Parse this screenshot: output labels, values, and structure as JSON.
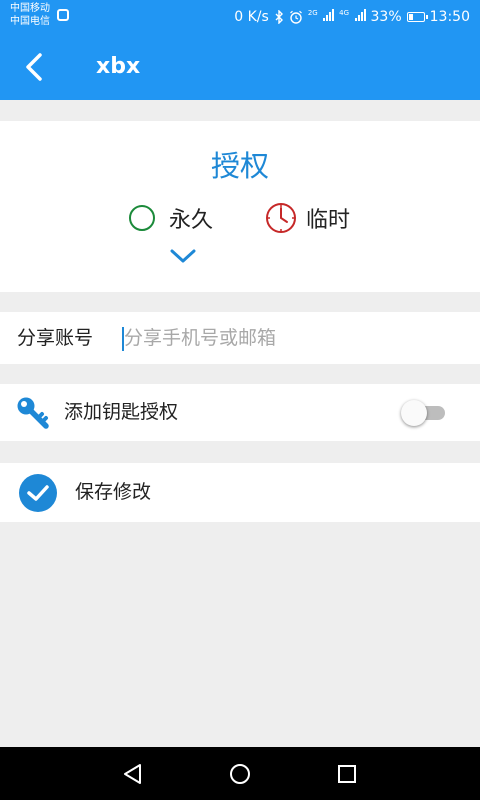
{
  "status_bar": {
    "carrier_1": "中国移动",
    "carrier_2": "中国电信",
    "net_speed": "0 K/s",
    "network_1": "2G",
    "network_2": "4G",
    "battery": "33%",
    "battery_level": 0.33,
    "time": "13:50"
  },
  "app_bar": {
    "title": "xbx"
  },
  "authorization": {
    "title": "授权",
    "options": [
      {
        "label": "永久",
        "icon": "circle-icon",
        "color": "#1b8a3a",
        "selected": true
      },
      {
        "label": "临时",
        "icon": "clock-icon",
        "color": "#c62828",
        "selected": false
      }
    ]
  },
  "share": {
    "label": "分享账号",
    "placeholder": "分享手机号或邮箱",
    "value": ""
  },
  "key_auth": {
    "label": "添加钥匙授权",
    "icon": "key-icon",
    "enabled": false
  },
  "save": {
    "label": "保存修改",
    "icon": "check-circle-icon"
  },
  "colors": {
    "primary": "#2196f3",
    "accent": "#1e88d6",
    "background": "#eeeeee"
  }
}
